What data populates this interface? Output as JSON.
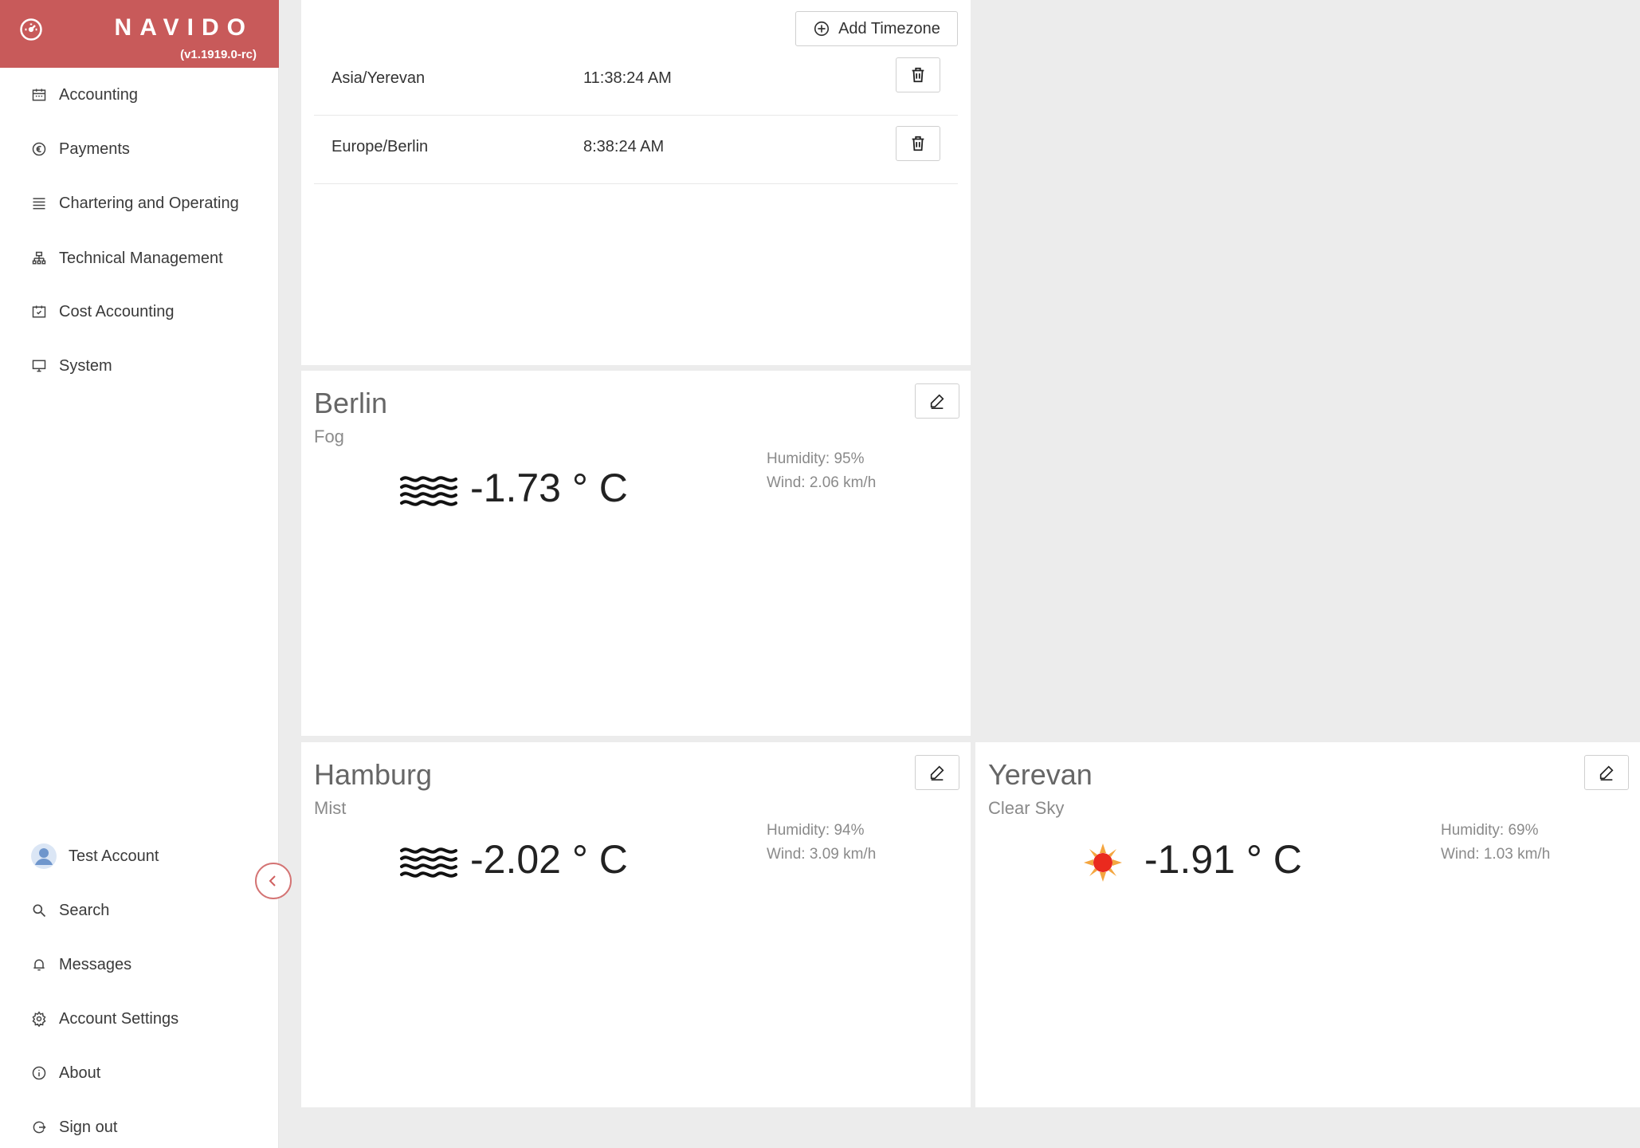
{
  "brand": {
    "name": "NAVIDO",
    "version": "(v1.1919.0-rc)",
    "color": "#c85a5a"
  },
  "sidebar": {
    "items": [
      {
        "label": "Accounting",
        "icon": "calendar-icon"
      },
      {
        "label": "Payments",
        "icon": "euro-circle-icon"
      },
      {
        "label": "Chartering and Operating",
        "icon": "list-icon"
      },
      {
        "label": "Technical Management",
        "icon": "org-chart-icon"
      },
      {
        "label": "Cost Accounting",
        "icon": "calendar-check-icon"
      },
      {
        "label": "System",
        "icon": "monitor-icon"
      }
    ],
    "bottom_items": [
      {
        "label": "Test Account",
        "icon": "avatar-icon"
      },
      {
        "label": "Search",
        "icon": "search-icon"
      },
      {
        "label": "Messages",
        "icon": "bell-icon"
      },
      {
        "label": "Account Settings",
        "icon": "gear-icon"
      },
      {
        "label": "About",
        "icon": "info-icon"
      },
      {
        "label": "Sign out",
        "icon": "sign-out-icon"
      }
    ]
  },
  "timezones": {
    "add_label": "Add Timezone",
    "rows": [
      {
        "zone": "Asia/Yerevan",
        "time": "11:38:24 AM"
      },
      {
        "zone": "Europe/Berlin",
        "time": "8:38:24 AM"
      }
    ]
  },
  "weather": [
    {
      "city": "Berlin",
      "condition": "Fog",
      "temp": "-1.73 ° C",
      "humidity": "Humidity: 95%",
      "wind": "Wind: 2.06 km/h",
      "icon": "fog-icon"
    },
    {
      "city": "Hamburg",
      "condition": "Mist",
      "temp": "-2.02 ° C",
      "humidity": "Humidity: 94%",
      "wind": "Wind: 3.09 km/h",
      "icon": "fog-icon"
    },
    {
      "city": "Yerevan",
      "condition": "Clear Sky",
      "temp": "-1.91 ° C",
      "humidity": "Humidity: 69%",
      "wind": "Wind: 1.03 km/h",
      "icon": "sun-icon"
    }
  ]
}
